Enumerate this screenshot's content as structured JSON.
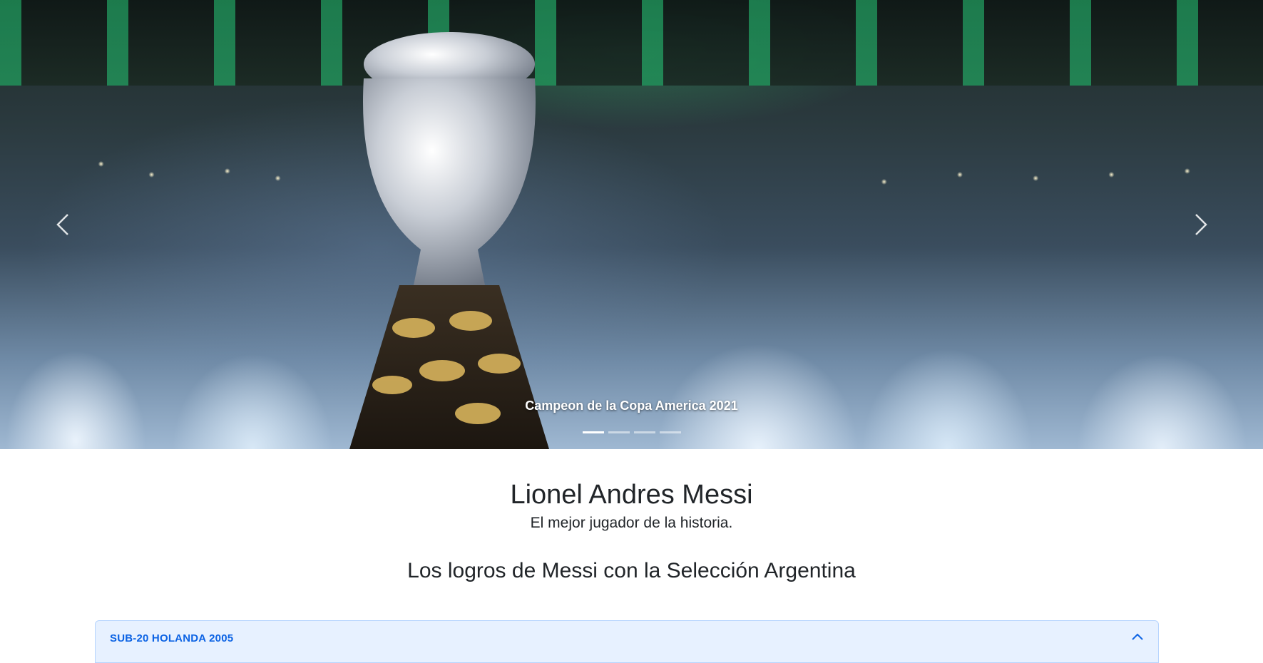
{
  "carousel": {
    "caption": "Campeon de la Copa America 2021",
    "prev_icon": "chevron-left-icon",
    "next_icon": "chevron-right-icon",
    "indicators": [
      {
        "active": true
      },
      {
        "active": false
      },
      {
        "active": false
      },
      {
        "active": false
      }
    ]
  },
  "hero": {
    "title": "Lionel Andres Messi",
    "subtitle": "El mejor jugador de la historia."
  },
  "achievements": {
    "heading": "Los logros de Messi con la Selección Argentina",
    "items": [
      {
        "label": "SUB-20 HOLANDA 2005",
        "expanded": true,
        "icon": "chevron-up-icon"
      }
    ]
  },
  "colors": {
    "accordion_bg": "#e7f1ff",
    "accordion_text": "#0c63e4",
    "text": "#212529"
  }
}
